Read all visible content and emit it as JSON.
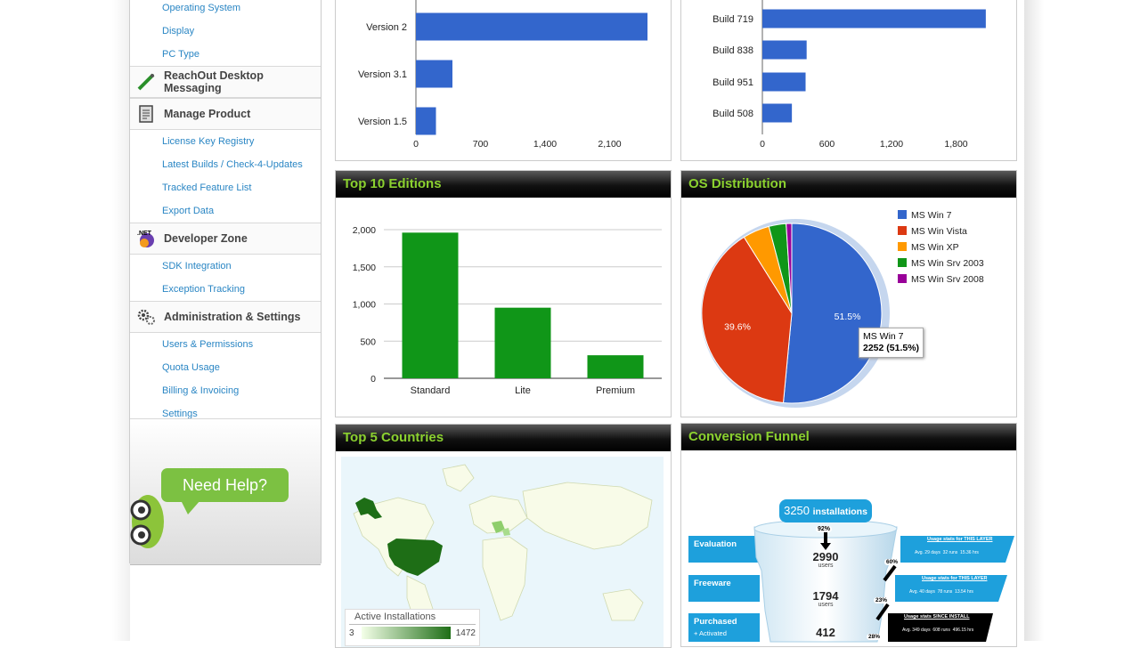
{
  "sidebar": {
    "top_links": [
      "Operating System",
      "Display",
      "PC Type"
    ],
    "sections": [
      {
        "title": "ReachOut Desktop Messaging",
        "icon": "pen-icon",
        "links": []
      },
      {
        "title": "Manage Product",
        "icon": "clipboard-icon",
        "links": [
          "License Key Registry",
          "Latest Builds / Check-4-Updates",
          "Tracked Feature List",
          "Export Data"
        ]
      },
      {
        "title": "Developer Zone",
        "icon": "dotnet-icon",
        "links": [
          "SDK Integration",
          "Exception Tracking"
        ]
      },
      {
        "title": "Administration & Settings",
        "icon": "gears-icon",
        "links": [
          "Users & Permissions",
          "Quota Usage",
          "Billing & Invoicing",
          "Settings"
        ]
      }
    ],
    "help": "Need Help?"
  },
  "panels": {
    "editions_title": "Top 10 Editions",
    "os_title": "OS Distribution",
    "countries_title": "Top 5 Countries",
    "funnel_title": "Conversion Funnel"
  },
  "map": {
    "legend_title": "Active Installations",
    "min": "3",
    "max": "1472"
  },
  "pie_tooltip": {
    "name": "MS Win 7",
    "value": "2252 (51.5%)"
  },
  "funnel": {
    "top_count": "3250",
    "top_label": "installations",
    "stages": [
      {
        "name": "Evaluation",
        "count": "2990",
        "unit": "users",
        "pct": "92%",
        "stats": "Usage stats for THIS LAYER",
        "detail": "Avg. 29 days  32 runs  15.36 hrs"
      },
      {
        "name": "Freeware",
        "count": "1794",
        "unit": "users",
        "pct": "60%",
        "stats": "Usage stats for THIS LAYER",
        "detail": "Avg. 40 days  78 runs  13.54 hrs"
      },
      {
        "name": "Purchased",
        "sub": "+ Activated",
        "count": "412",
        "unit": "",
        "pct": "23%",
        "stats": "Usage stats SINCE INSTALL",
        "detail": "Avg. 349 days  608 runs  496.15 hrs"
      }
    ],
    "last_pct": "28%"
  },
  "chart_data": [
    {
      "type": "bar",
      "orientation": "horizontal",
      "categories": [
        "Version 2",
        "Version 3.1",
        "Version 1.5"
      ],
      "values": [
        2600,
        410,
        225
      ],
      "xlim": [
        0,
        2800
      ],
      "xticks": [
        "0",
        "700",
        "1,400",
        "2,100"
      ],
      "color": "#3366cc"
    },
    {
      "type": "bar",
      "orientation": "horizontal",
      "categories": [
        "Build 719",
        "Build 838",
        "Build 951",
        "Build 508"
      ],
      "values": [
        2120,
        420,
        410,
        280
      ],
      "xlim": [
        0,
        2400
      ],
      "xticks": [
        "0",
        "600",
        "1,200",
        "1,800"
      ],
      "color": "#3366cc"
    },
    {
      "type": "bar",
      "categories": [
        "Standard",
        "Lite",
        "Premium"
      ],
      "values": [
        1960,
        950,
        310
      ],
      "ylim": [
        0,
        2000
      ],
      "yticks": [
        "0",
        "500",
        "1,000",
        "1,500",
        "2,000"
      ],
      "color": "#109618"
    },
    {
      "type": "pie",
      "labels": [
        "MS Win 7",
        "MS Win Vista",
        "MS Win XP",
        "MS Win Srv 2003",
        "MS Win Srv 2008"
      ],
      "values": [
        51.5,
        39.6,
        4.8,
        3.1,
        1.0
      ],
      "slice_labels": [
        "51.5%",
        "39.6%",
        "",
        "",
        ""
      ],
      "colors": [
        "#3366cc",
        "#dc3912",
        "#ff9900",
        "#109618",
        "#990099"
      ],
      "legend_position": "right"
    }
  ]
}
